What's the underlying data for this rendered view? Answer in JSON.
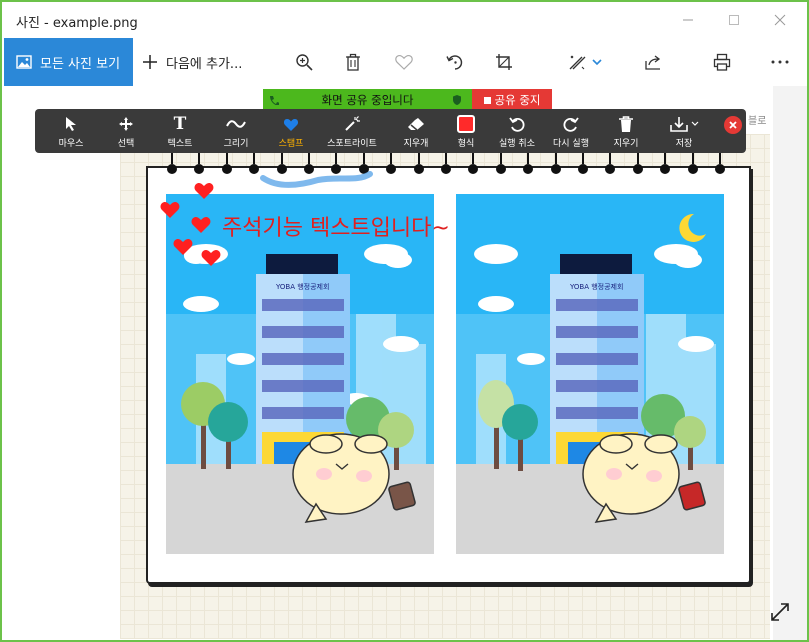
{
  "window": {
    "title": "사진 - example.png",
    "controls": [
      "minimize-icon",
      "maximize-icon",
      "close-icon"
    ]
  },
  "toolbar": {
    "all_photos_label": "모든 사진 보기",
    "add_to_label": "다음에 추가...",
    "icons": [
      "zoom-icon",
      "delete-icon",
      "favorite-icon",
      "rotate-icon",
      "crop-icon",
      "edit-icon",
      "share-icon",
      "print-icon",
      "more-icon"
    ]
  },
  "share": {
    "banner_label": "화면 공유 중입니다",
    "stop_label": "공유 중지"
  },
  "annotation": {
    "tools": [
      {
        "label": "마우스",
        "icon": "cursor-icon"
      },
      {
        "label": "선택",
        "icon": "move-icon"
      },
      {
        "label": "텍스트",
        "icon": "text-icon"
      },
      {
        "label": "그리기",
        "icon": "draw-icon"
      },
      {
        "label": "스탬프",
        "icon": "heart-icon",
        "active": true
      },
      {
        "label": "스포트라이트",
        "icon": "spotlight-icon"
      },
      {
        "label": "지우개",
        "icon": "eraser-icon"
      },
      {
        "label": "형식",
        "icon": "format-icon"
      },
      {
        "label": "실행 취소",
        "icon": "undo-icon"
      },
      {
        "label": "다시 실행",
        "icon": "redo-icon"
      },
      {
        "label": "지우기",
        "icon": "trash-icon"
      },
      {
        "label": "저장",
        "icon": "save-icon"
      }
    ],
    "side_hint": "블로",
    "accent": "#ffb300",
    "format_color": "#ff2a2a"
  },
  "image": {
    "annotation_text": "주석기능 텍스트입니다~",
    "building_sign": "YOBA 행정공제회",
    "stamp_color": "#ff2020"
  }
}
